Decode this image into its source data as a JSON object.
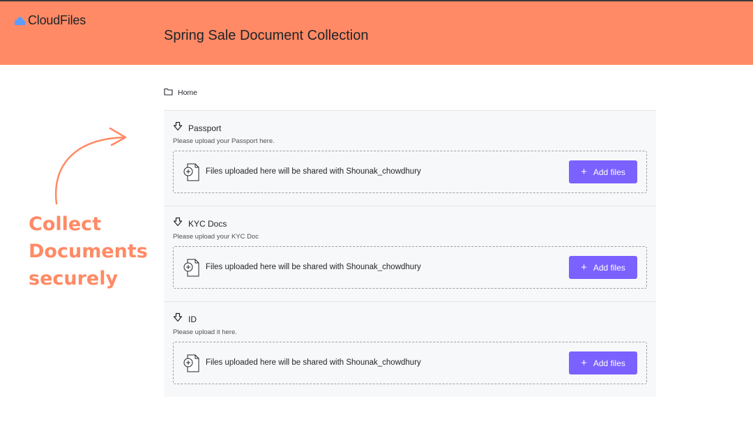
{
  "app": {
    "logo_icon": "cloud-icon",
    "logo_text": "CloudFiles",
    "title": "Spring Sale Document Collection"
  },
  "breadcrumb": {
    "icon": "folder-icon",
    "label": "Home"
  },
  "sections": [
    {
      "title": "Passport",
      "description": "Please upload your Passport here.",
      "dropzone_text": "Files uploaded here will be shared with Shounak_chowdhury",
      "button_label": "Add files"
    },
    {
      "title": "KYC Docs",
      "description": "Please upload your KYC Doc",
      "dropzone_text": "Files uploaded here will be shared with Shounak_chowdhury",
      "button_label": "Add files"
    },
    {
      "title": "ID",
      "description": "Please upload it here.",
      "dropzone_text": "Files uploaded here will be shared with Shounak_chowdhury",
      "button_label": "Add files"
    }
  ],
  "promo": {
    "lines": [
      "Collect",
      "Documents",
      "securely"
    ]
  },
  "colors": {
    "header_bg": "#ff8a65",
    "accent_button": "#7b61ff",
    "promo_text": "#ff8a65",
    "logo_cloud": "#5b9dff"
  }
}
